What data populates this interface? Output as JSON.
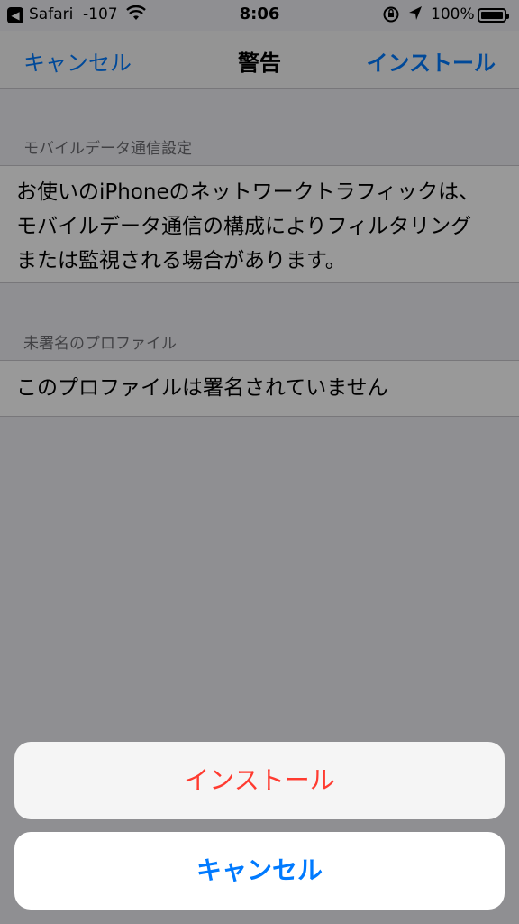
{
  "status_bar": {
    "back_glyph": "◀",
    "app": "Safari",
    "signal": "-107",
    "wifi_glyph": "wifi-icon",
    "time": "8:06",
    "battery_pct": "100%"
  },
  "nav": {
    "left_label": "キャンセル",
    "title": "警告",
    "right_label": "インストール"
  },
  "sections": [
    {
      "header": "モバイルデータ通信設定",
      "lines": [
        "お使いのiPhoneのネットワークトラフィックは、",
        "モバイルデータ通信の構成によりフィルタリング",
        "または監視される場合があります。"
      ]
    },
    {
      "header": "未署名のプロファイル",
      "lines": [
        "このプロファイルは署名されていません"
      ]
    }
  ],
  "action_sheet": {
    "install_label": "インストール",
    "cancel_label": "キャンセル"
  },
  "colors": {
    "accent": "#007aff",
    "destructive": "#ff3b30",
    "background": "#efeff4"
  }
}
